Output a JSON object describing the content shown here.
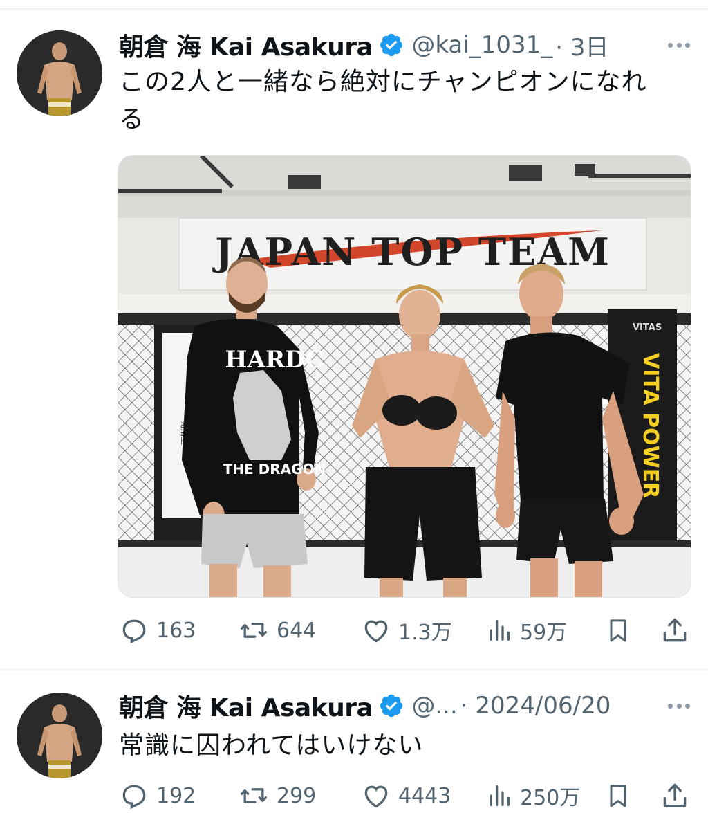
{
  "colors": {
    "verified": "#1d9bf0",
    "secondary_text": "#536471",
    "divider": "#eff3f4"
  },
  "tweets": [
    {
      "author_name": "朝倉 海 Kai Asakura",
      "handle": "@kai_1031_",
      "timestamp": "· 3日",
      "text_line1": "この2人と一緒なら絶対にチャンピオンになれ",
      "text_line2": "る",
      "media": {
        "banner_text": "JAPAN TOP TEAM",
        "shirt_text_top": "HARDC",
        "shirt_text_bottom": "THE DRAGON",
        "pad_text": "VITA POWER",
        "pad_brand": "VITAS"
      },
      "replies": "163",
      "reposts": "644",
      "likes": "1.3万",
      "views": "59万"
    },
    {
      "author_name": "朝倉 海 Kai Asakura",
      "handle": "@...",
      "timestamp": "· 2024/06/20",
      "text_line1": "常識に囚われてはいけない",
      "replies": "192",
      "reposts": "299",
      "likes": "4443",
      "views": "250万"
    }
  ],
  "icons": [
    "reply-icon",
    "repost-icon",
    "like-icon",
    "views-icon",
    "bookmark-icon",
    "share-icon",
    "more-icon",
    "verified-badge-icon"
  ]
}
